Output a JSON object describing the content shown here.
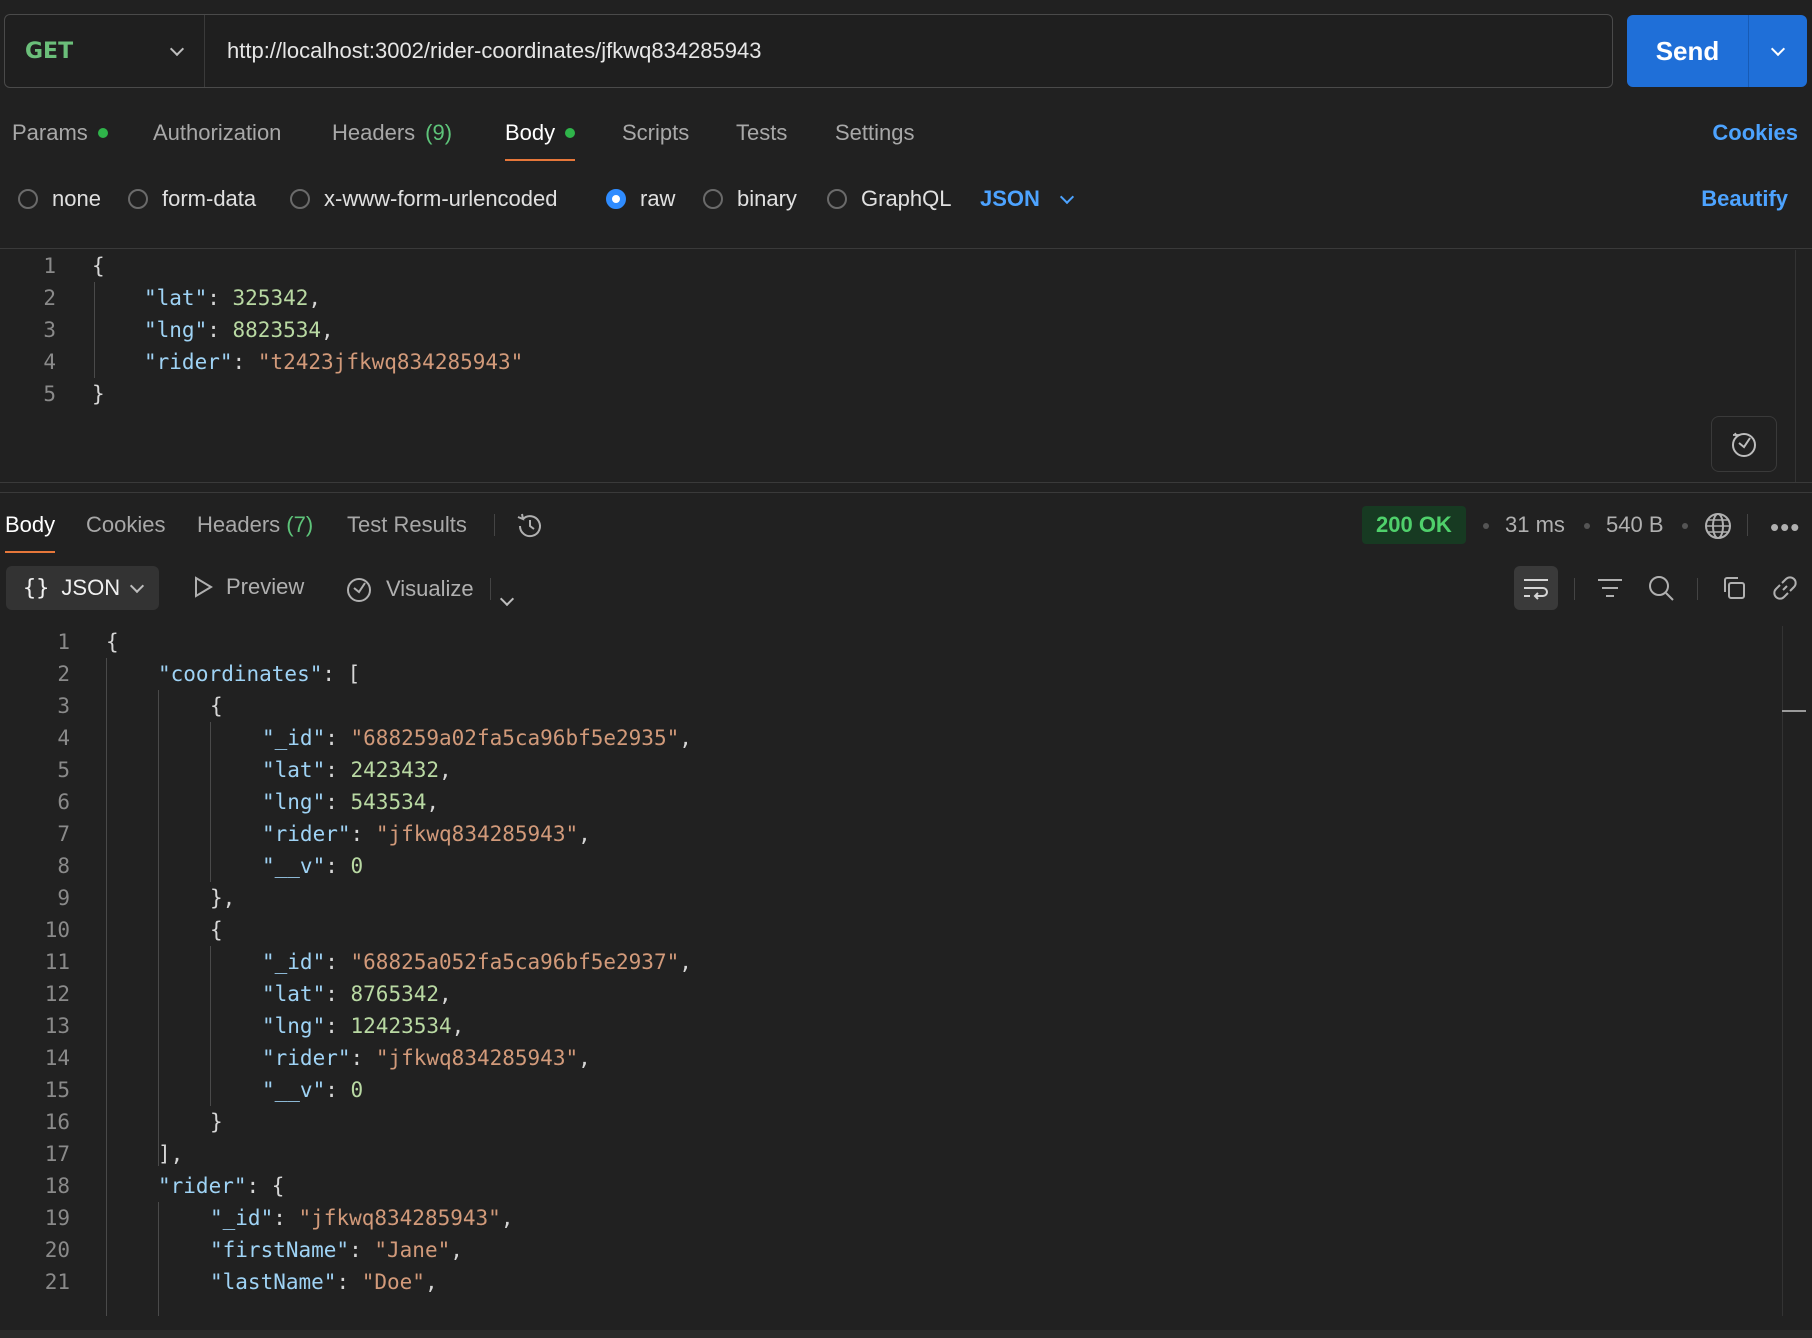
{
  "request": {
    "method": "GET",
    "url": "http://localhost:3002/rider-coordinates/jfkwq834285943",
    "send_label": "Send"
  },
  "request_tabs": {
    "params": "Params",
    "authorization": "Authorization",
    "headers": "Headers",
    "headers_count": "(9)",
    "body": "Body",
    "scripts": "Scripts",
    "tests": "Tests",
    "settings": "Settings",
    "cookies": "Cookies"
  },
  "body_types": {
    "none": "none",
    "form_data": "form-data",
    "urlencoded": "x-www-form-urlencoded",
    "raw": "raw",
    "binary": "binary",
    "graphql": "GraphQL",
    "language": "JSON",
    "selected": "raw",
    "beautify": "Beautify"
  },
  "request_body": {
    "line_numbers": [
      "1",
      "2",
      "3",
      "4",
      "5"
    ],
    "lat_key": "\"lat\"",
    "lat_val": "325342",
    "lng_key": "\"lng\"",
    "lng_val": "8823534",
    "rider_key": "\"rider\"",
    "rider_val": "\"t2423jfkwq834285943\""
  },
  "response_tabs": {
    "body": "Body",
    "cookies": "Cookies",
    "headers": "Headers",
    "headers_count": "(7)",
    "test_results": "Test Results",
    "status": "200 OK",
    "time": "31 ms",
    "size": "540 B"
  },
  "response_toolbar": {
    "format": "JSON",
    "preview": "Preview",
    "visualize": "Visualize"
  },
  "response_body": {
    "line_numbers": [
      "1",
      "2",
      "3",
      "4",
      "5",
      "6",
      "7",
      "8",
      "9",
      "10",
      "11",
      "12",
      "13",
      "14",
      "15",
      "16",
      "17",
      "18",
      "19",
      "20",
      "21"
    ],
    "coordinates_key": "\"coordinates\"",
    "id_key": "\"_id\"",
    "lat_key": "\"lat\"",
    "lng_key": "\"lng\"",
    "rider_key": "\"rider\"",
    "v_key": "\"__v\"",
    "first_name_key": "\"firstName\"",
    "last_name_key": "\"lastName\"",
    "items": [
      {
        "id": "\"688259a02fa5ca96bf5e2935\"",
        "lat": "2423432",
        "lng": "543534",
        "rider": "\"jfkwq834285943\"",
        "v": "0"
      },
      {
        "id": "\"68825a052fa5ca96bf5e2937\"",
        "lat": "8765342",
        "lng": "12423534",
        "rider": "\"jfkwq834285943\"",
        "v": "0"
      }
    ],
    "rider": {
      "id": "\"jfkwq834285943\"",
      "first_name": "\"Jane\"",
      "last_name": "\"Doe\""
    }
  }
}
